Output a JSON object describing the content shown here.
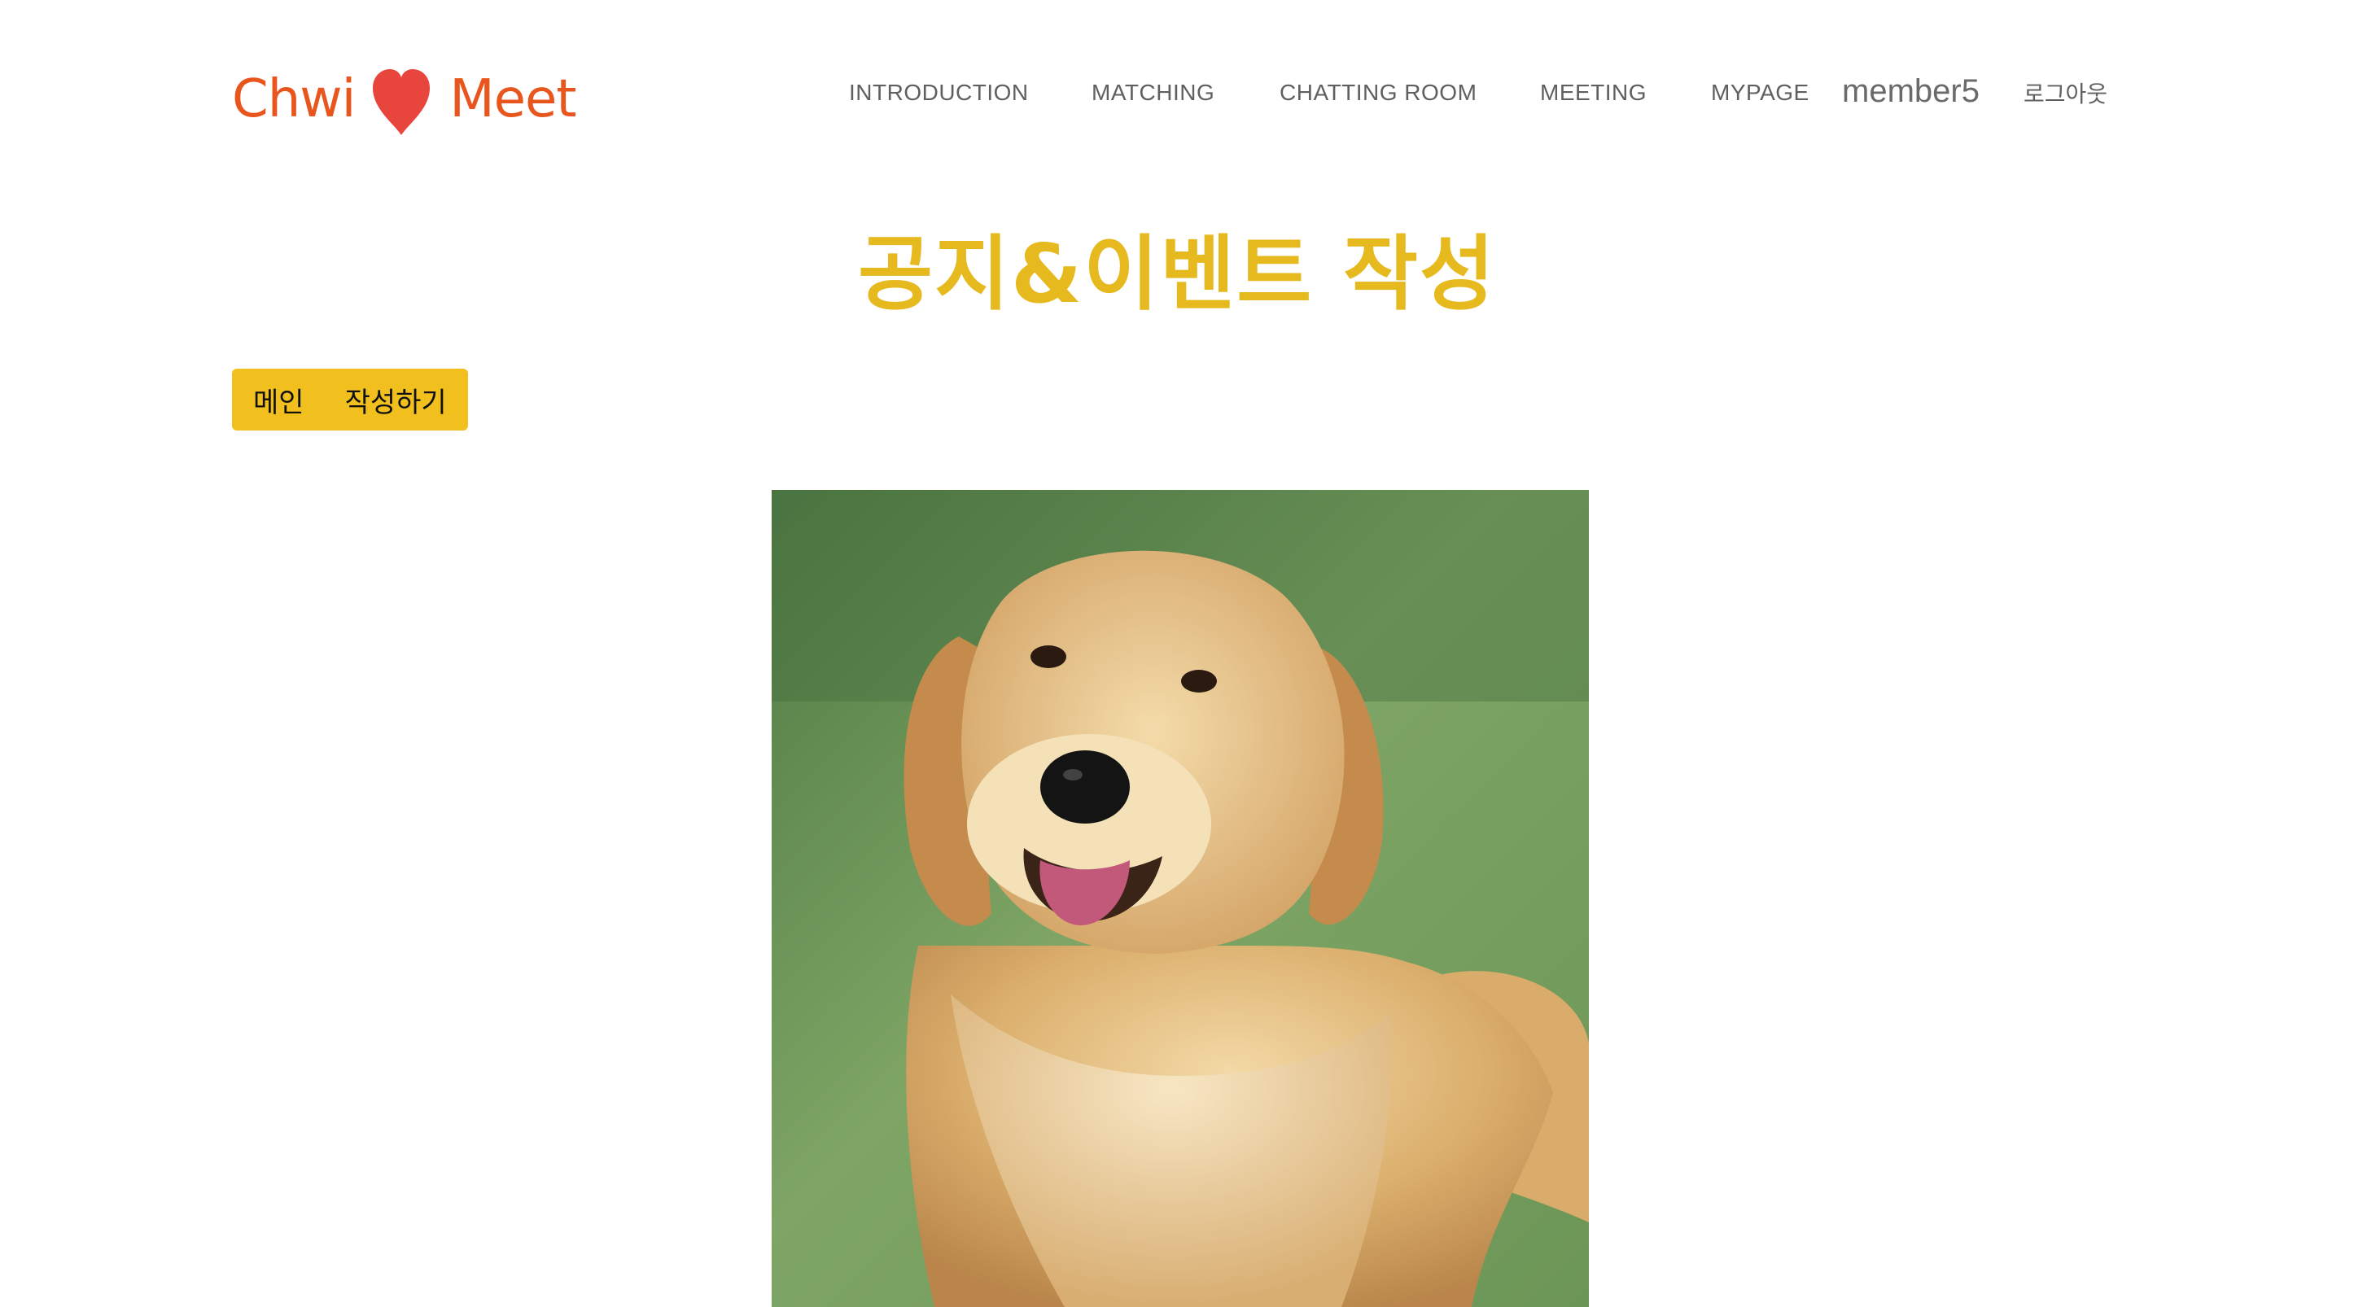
{
  "header": {
    "logo_left": "Chwi",
    "logo_right": "Meet",
    "nav": {
      "introduction": "INTRODUCTION",
      "matching": "MATCHING",
      "chatting_room": "CHATTING ROOM",
      "meeting": "MEETING",
      "mypage": "MYPAGE"
    },
    "username": "member5",
    "logout": "로그아웃"
  },
  "main": {
    "title": "공지&이벤트 작성",
    "buttons": {
      "main": "메인",
      "write": "작성하기"
    },
    "photo": {
      "subject": "golden-retriever-photo"
    }
  },
  "colors": {
    "logo": "#e8561e",
    "heart": "#e8463c",
    "title": "#e6b91e",
    "button_bg": "#f2c01e",
    "nav_text": "#5f5f5f"
  }
}
